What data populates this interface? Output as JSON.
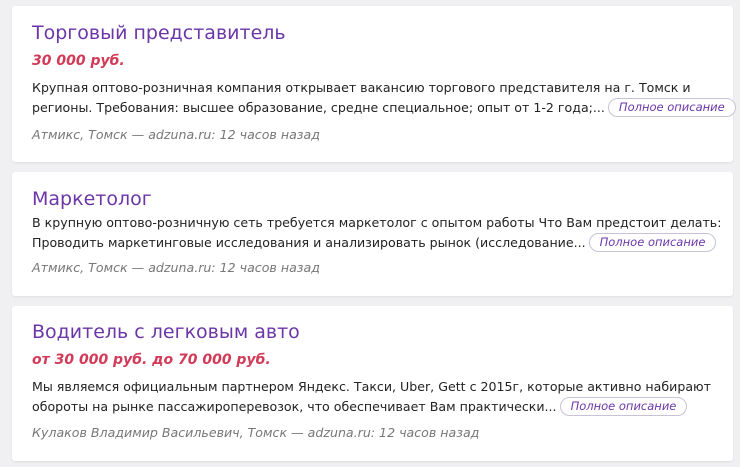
{
  "jobs": [
    {
      "title": "Торговый представитель",
      "salary": "30 000 руб.",
      "description_line1": "Крупная оптово-розничная компания открывает вакансию торгового представителя на г. Томск и",
      "description_line2": "регионы. Требования: высшее образование, средне специальное; опыт от 1-2 года;...",
      "more_label": "Полное описание",
      "meta": "Атмикс, Томск — adzuna.ru: 12 часов назад"
    },
    {
      "title": "Маркетолог",
      "description_line1": "В крупную оптово-розничную сеть требуется маркетолог с опытом работы Что Вам предстоит делать:",
      "description_line2": "Проводить маркетинговые исследования и анализировать рынок (исследование...",
      "more_label": "Полное описание",
      "meta": "Атмикс, Томск — adzuna.ru: 12 часов назад"
    },
    {
      "title": "Водитель с легковым авто",
      "salary": "от 30 000 руб. до 70 000 руб.",
      "description_line1": "Мы являемся официальным партнером Яндекс. Такси, Uber, Gett с 2015г, которые активно набирают",
      "description_line2": "обороты на рынке пассажироперевозок, что обеспечивает Вам практически...",
      "more_label": "Полное описание",
      "meta": "Кулаков Владимир Васильевич, Томск — adzuna.ru: 12 часов назад"
    }
  ],
  "colors": {
    "title": "#6b36a8",
    "salary": "#d23a57",
    "meta": "#777777",
    "background": "#f0f0f2"
  }
}
